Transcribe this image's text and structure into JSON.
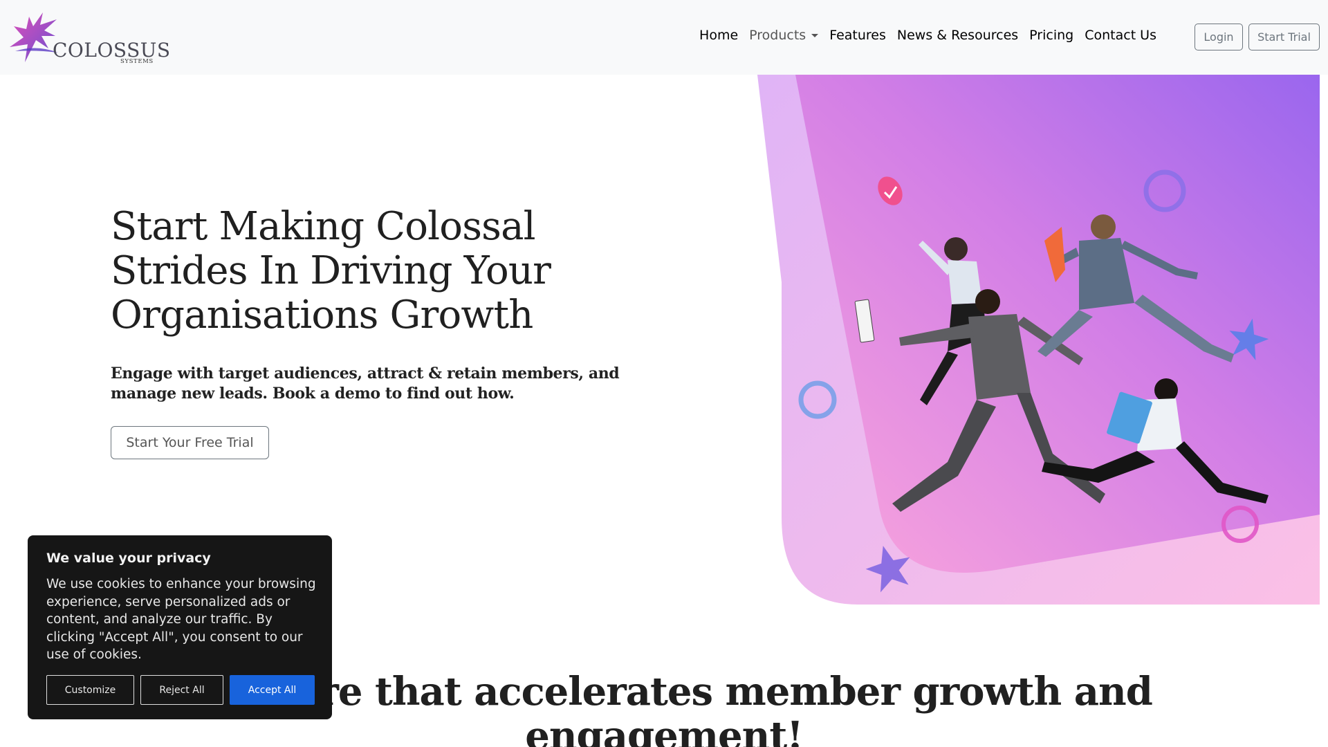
{
  "brand": {
    "name": "COLOSSUS",
    "subtitle": "SYSTEMS",
    "logo_icon": "star-burst-logo-icon"
  },
  "nav": {
    "items": [
      {
        "label": "Home"
      },
      {
        "label": "Products",
        "has_dropdown": true
      },
      {
        "label": "Features"
      },
      {
        "label": "News & Resources"
      },
      {
        "label": "Pricing"
      },
      {
        "label": "Contact Us"
      }
    ],
    "login_label": "Login",
    "start_trial_label": "Start Trial"
  },
  "hero": {
    "title": "Start Making Colossal Strides In Driving Your Organisations Growth",
    "subtitle": "Engage with target audiences, attract & retain members, and manage new leads. Book a demo to find out how.",
    "cta_label": "Start Your Free Trial",
    "image_description_icon": "jumping-business-people-image"
  },
  "section": {
    "heading": "Software that accelerates member growth and engagement!"
  },
  "cookie_banner": {
    "title": "We value your privacy",
    "body": "We use cookies to enhance your browsing experience, serve personalized ads or content, and analyze our traffic. By clicking \"Accept All\", you consent to our use of cookies.",
    "customize_label": "Customize",
    "reject_label": "Reject All",
    "accept_label": "Accept All"
  },
  "colors": {
    "nav_bg": "#f8f9fa",
    "hero_gradient_start": "#9a6cf0",
    "hero_gradient_end": "#f9a8e0",
    "cookie_bg": "#161616",
    "accept_button": "#1863dc"
  }
}
